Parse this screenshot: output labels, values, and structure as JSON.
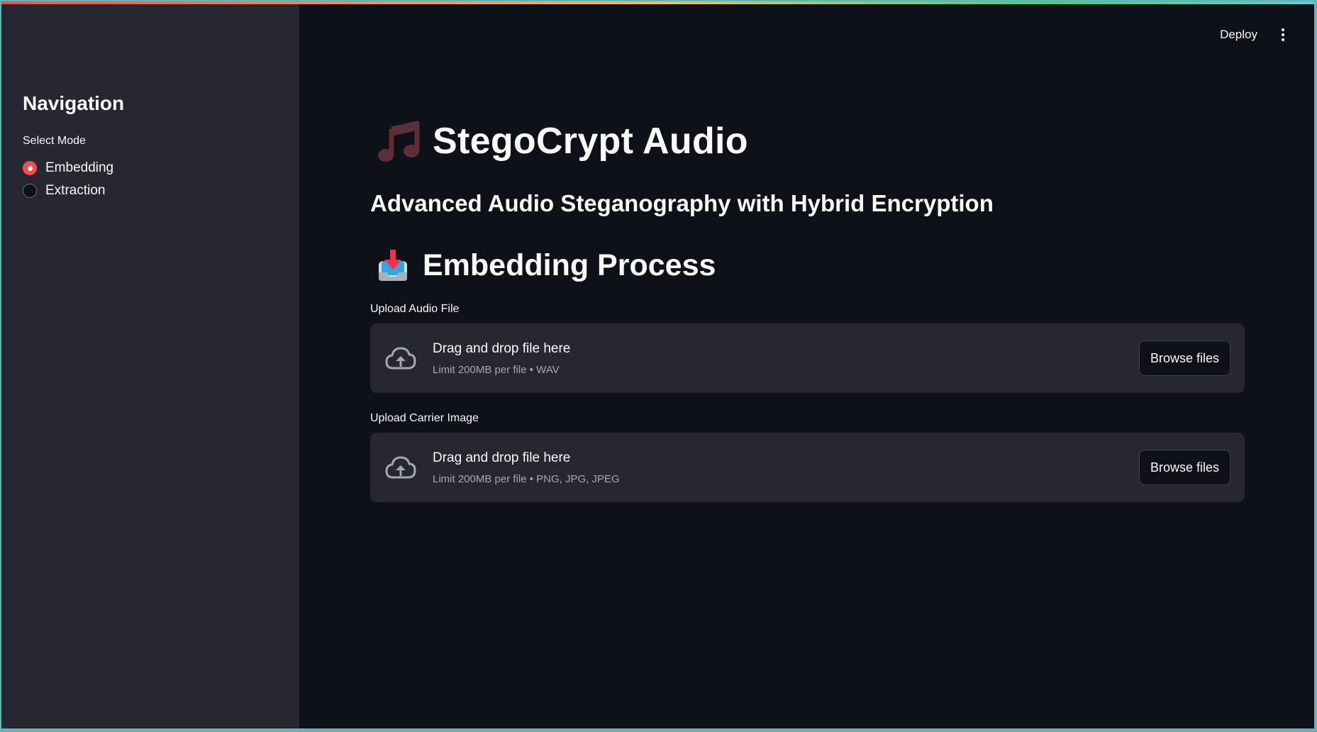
{
  "header": {
    "deploy_label": "Deploy",
    "menu_icon": "kebab-menu-icon"
  },
  "sidebar": {
    "title": "Navigation",
    "select_label": "Select Mode",
    "options": [
      {
        "label": "Embedding",
        "selected": true
      },
      {
        "label": "Extraction",
        "selected": false
      }
    ]
  },
  "main": {
    "app_title": "StegoCrypt Audio",
    "title_icon": "music-note-icon",
    "subtitle": "Advanced Audio Steganography with Hybrid Encryption",
    "section_title": "Embedding Process",
    "section_icon": "inbox-tray-icon",
    "uploaders": [
      {
        "label": "Upload Audio File",
        "drop_text": "Drag and drop file here",
        "limit_text": "Limit 200MB per file • WAV",
        "button_label": "Browse files"
      },
      {
        "label": "Upload Carrier Image",
        "drop_text": "Drag and drop file here",
        "limit_text": "Limit 200MB per file • PNG, JPG, JPEG",
        "button_label": "Browse files"
      }
    ]
  },
  "colors": {
    "background": "#0e1117",
    "sidebar": "#262730",
    "accent": "#ff4b4b",
    "dropzone": "#262730",
    "frame": "#5fb8b8"
  }
}
